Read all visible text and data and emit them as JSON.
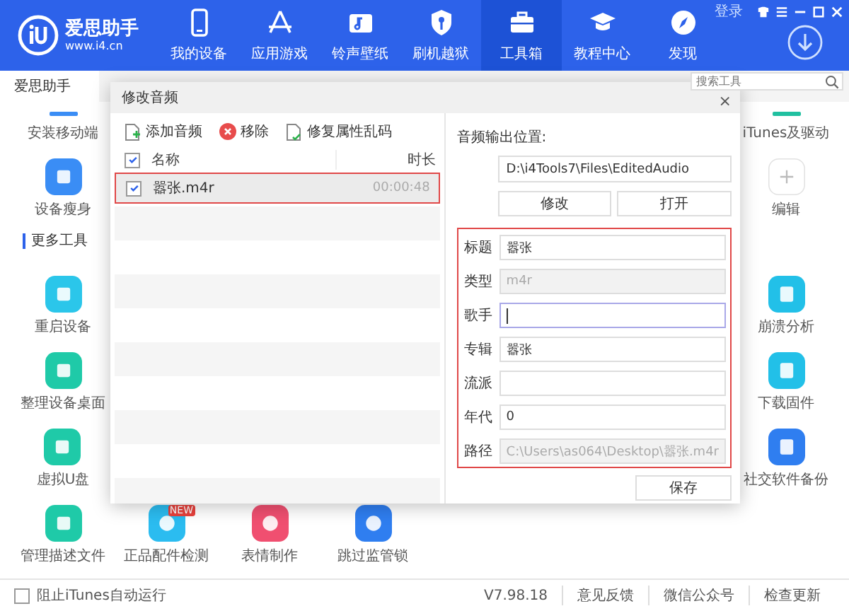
{
  "app": {
    "name": "爱思助手",
    "url": "www.i4.cn",
    "login": "登录"
  },
  "nav": [
    {
      "label": "我的设备",
      "selected": false
    },
    {
      "label": "应用游戏",
      "selected": false
    },
    {
      "label": "铃声壁纸",
      "selected": false
    },
    {
      "label": "刷机越狱",
      "selected": false
    },
    {
      "label": "工具箱",
      "selected": true
    },
    {
      "label": "教程中心",
      "selected": false
    },
    {
      "label": "发现",
      "selected": false
    }
  ],
  "page_tab": "爱思助手",
  "search": {
    "placeholder": "搜索工具"
  },
  "section_title": "更多工具",
  "tools_left": [
    {
      "label": "安装移动端"
    },
    {
      "label": "设备瘦身"
    },
    {
      "label": "重启设备"
    },
    {
      "label": "整理设备桌面"
    },
    {
      "label": "虚拟U盘"
    },
    {
      "label": "管理描述文件"
    }
  ],
  "tools_bottom": [
    {
      "label": "正品配件检测",
      "badge": "NEW"
    },
    {
      "label": "表情制作"
    },
    {
      "label": "跳过监管锁"
    }
  ],
  "tools_right": [
    {
      "label": "iTunes及驱动"
    },
    {
      "label": "编辑"
    },
    {
      "label": "崩溃分析"
    },
    {
      "label": "下载固件"
    },
    {
      "label": "社交软件备份"
    }
  ],
  "dialog": {
    "title": "修改音频",
    "close": "×",
    "toolbar": [
      "添加音频",
      "移除",
      "修复属性乱码"
    ],
    "columns": [
      "名称",
      "时长"
    ],
    "all_checked": true,
    "files": [
      {
        "name": "嚣张.m4r",
        "duration": "00:00:48",
        "checked": true,
        "selected": true
      }
    ],
    "output_label": "音频输出位置:",
    "output_path": "D:\\i4Tools7\\Files\\EditedAudio",
    "output_buttons": [
      "修改",
      "打开"
    ],
    "fields": [
      {
        "label": "标题",
        "value": "嚣张",
        "disabled": false,
        "focused": false
      },
      {
        "label": "类型",
        "value": "m4r",
        "disabled": true,
        "focused": false
      },
      {
        "label": "歌手",
        "disabled": false,
        "focused": true
      },
      {
        "label": "专辑",
        "value": "嚣张",
        "disabled": false,
        "focused": false
      },
      {
        "label": "流派",
        "disabled": false,
        "focused": false
      },
      {
        "label": "年代",
        "value": "0",
        "disabled": false,
        "focused": false
      },
      {
        "label": "路径",
        "value": "C:\\Users\\as064\\Desktop\\嚣张.m4r",
        "disabled": true,
        "focused": false
      }
    ],
    "save": "保存"
  },
  "footer": {
    "itunes_block": {
      "label": "阻止iTunes自动运行",
      "checked": false
    },
    "version": "V7.98.18",
    "links": [
      "意见反馈",
      "微信公众号",
      "检查更新"
    ]
  }
}
